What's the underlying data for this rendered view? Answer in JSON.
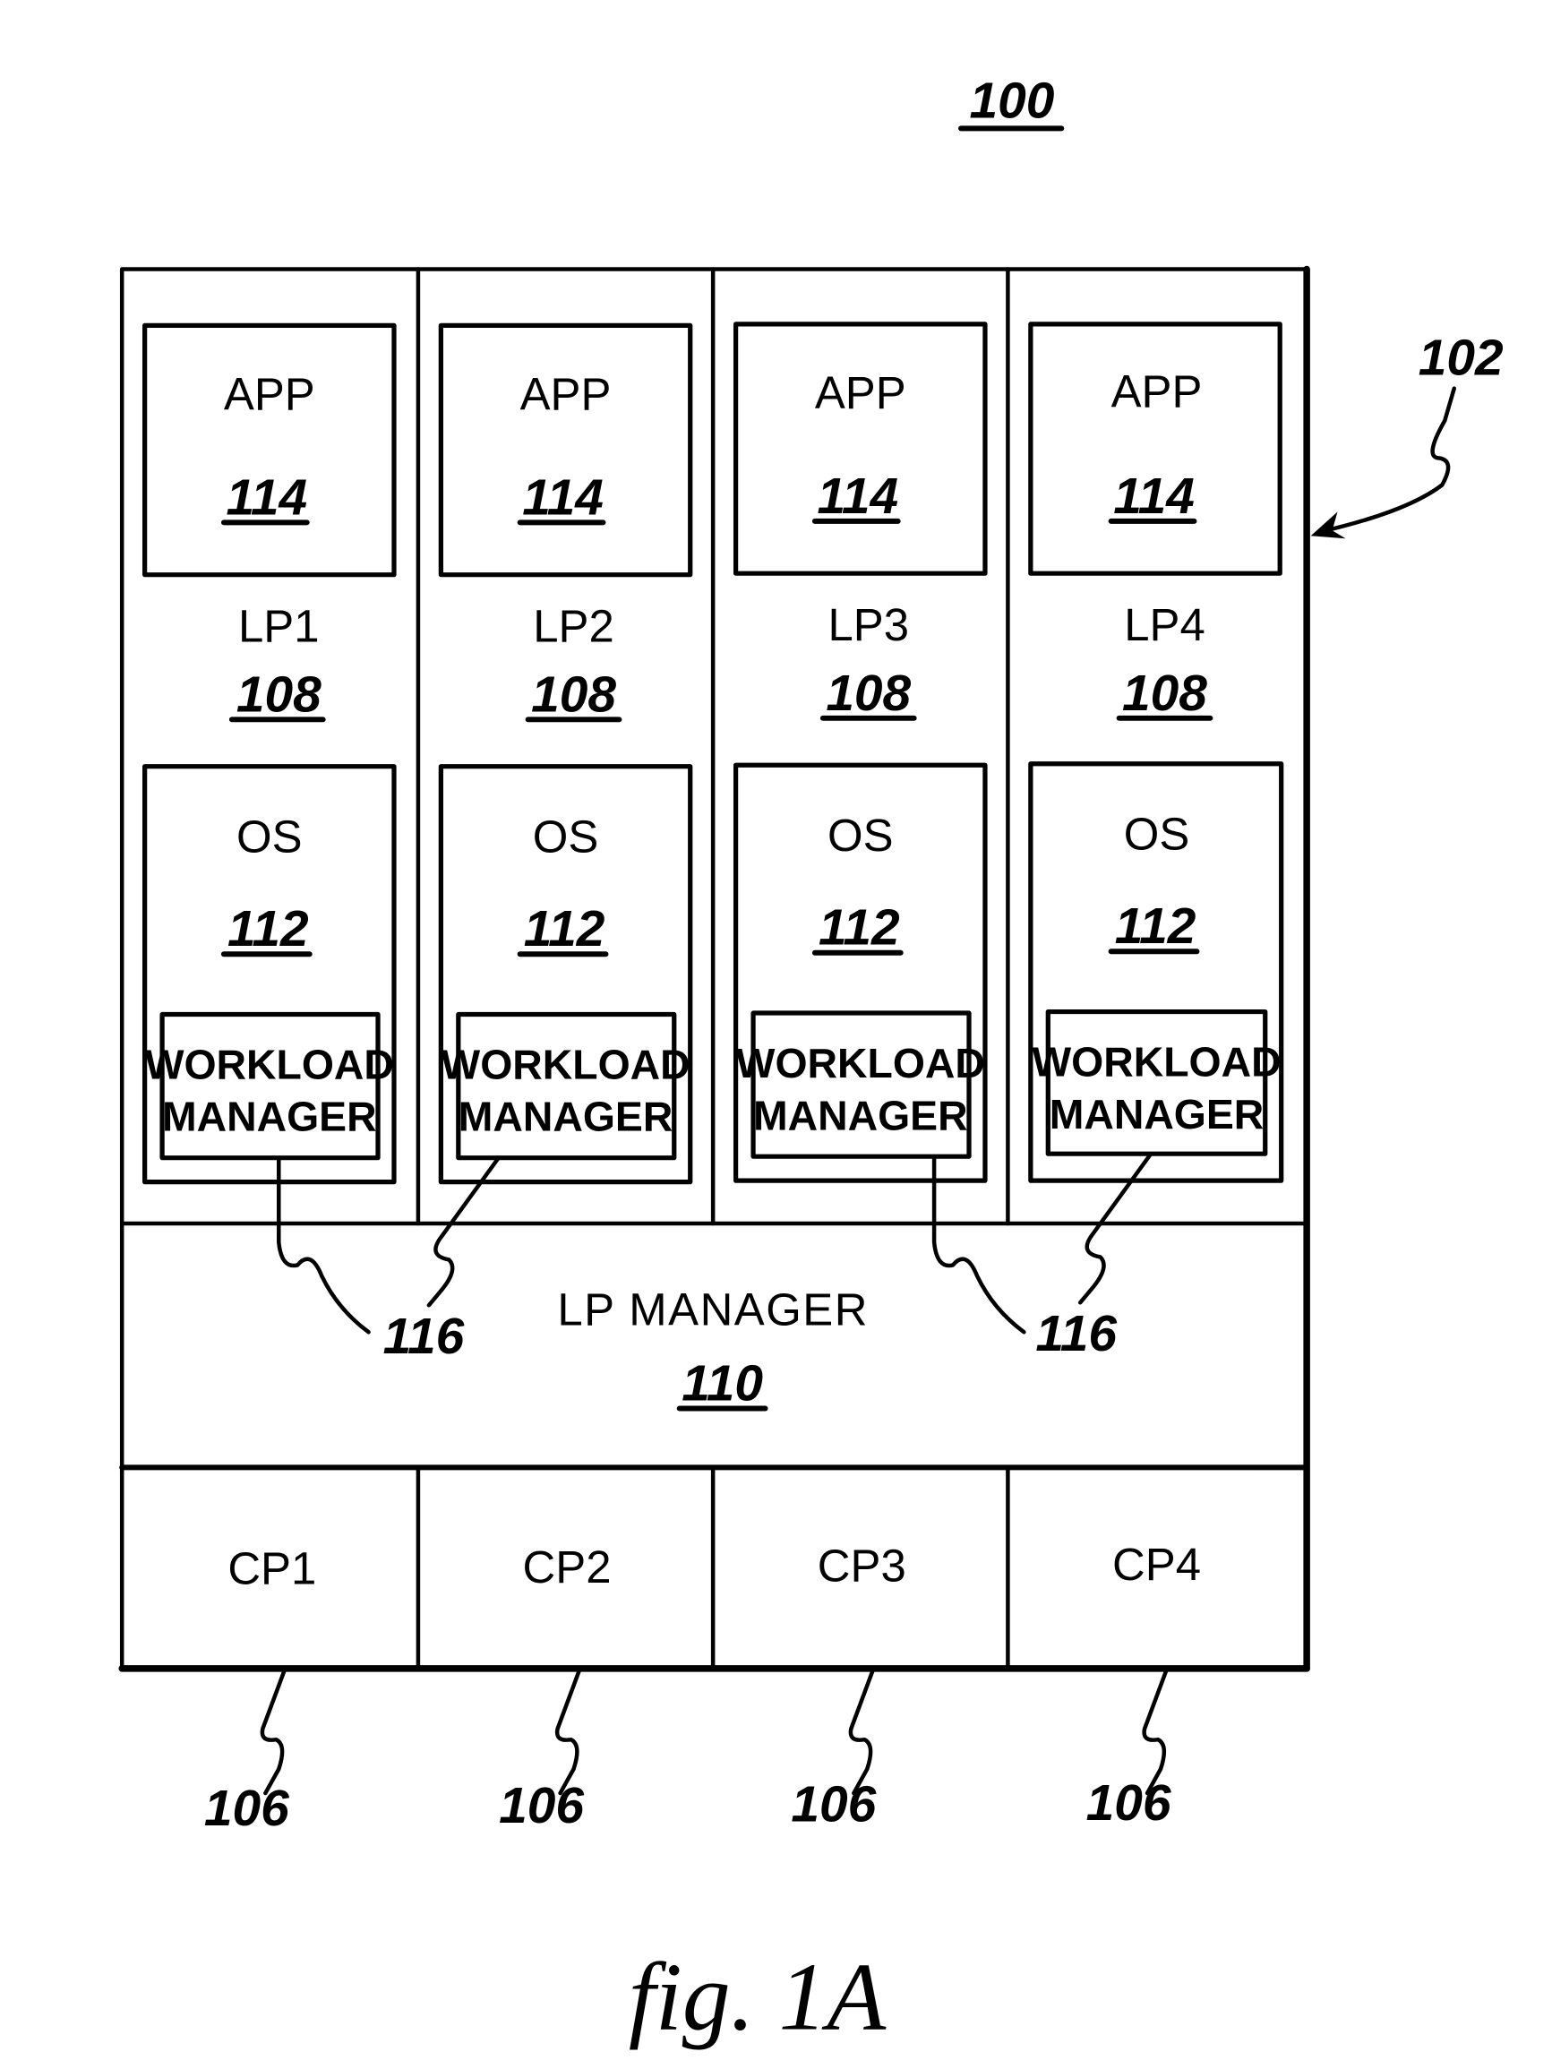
{
  "figure": {
    "caption": "fig.  1A",
    "system_ref": "100",
    "frame_ref": "102",
    "partitions": [
      {
        "name": "LP1",
        "ref": "108",
        "app": {
          "label": "APP",
          "ref": "114"
        },
        "os": {
          "label": "OS",
          "ref": "112"
        },
        "wlm": [
          "WORKLOAD",
          "MANAGER"
        ]
      },
      {
        "name": "LP2",
        "ref": "108",
        "app": {
          "label": "APP",
          "ref": "114"
        },
        "os": {
          "label": "OS",
          "ref": "112"
        },
        "wlm": [
          "WORKLOAD",
          "MANAGER"
        ]
      },
      {
        "name": "LP3",
        "ref": "108",
        "app": {
          "label": "APP",
          "ref": "114"
        },
        "os": {
          "label": "OS",
          "ref": "112"
        },
        "wlm": [
          "WORKLOAD",
          "MANAGER"
        ]
      },
      {
        "name": "LP4",
        "ref": "108",
        "app": {
          "label": "APP",
          "ref": "114"
        },
        "os": {
          "label": "OS",
          "ref": "112"
        },
        "wlm": [
          "WORKLOAD",
          "MANAGER"
        ]
      }
    ],
    "wlm_refs": [
      "116",
      "116"
    ],
    "lp_manager": {
      "label": "LP  MANAGER",
      "ref": "110"
    },
    "processors": [
      {
        "name": "CP1",
        "ref": "106"
      },
      {
        "name": "CP2",
        "ref": "106"
      },
      {
        "name": "CP3",
        "ref": "106"
      },
      {
        "name": "CP4",
        "ref": "106"
      }
    ]
  }
}
